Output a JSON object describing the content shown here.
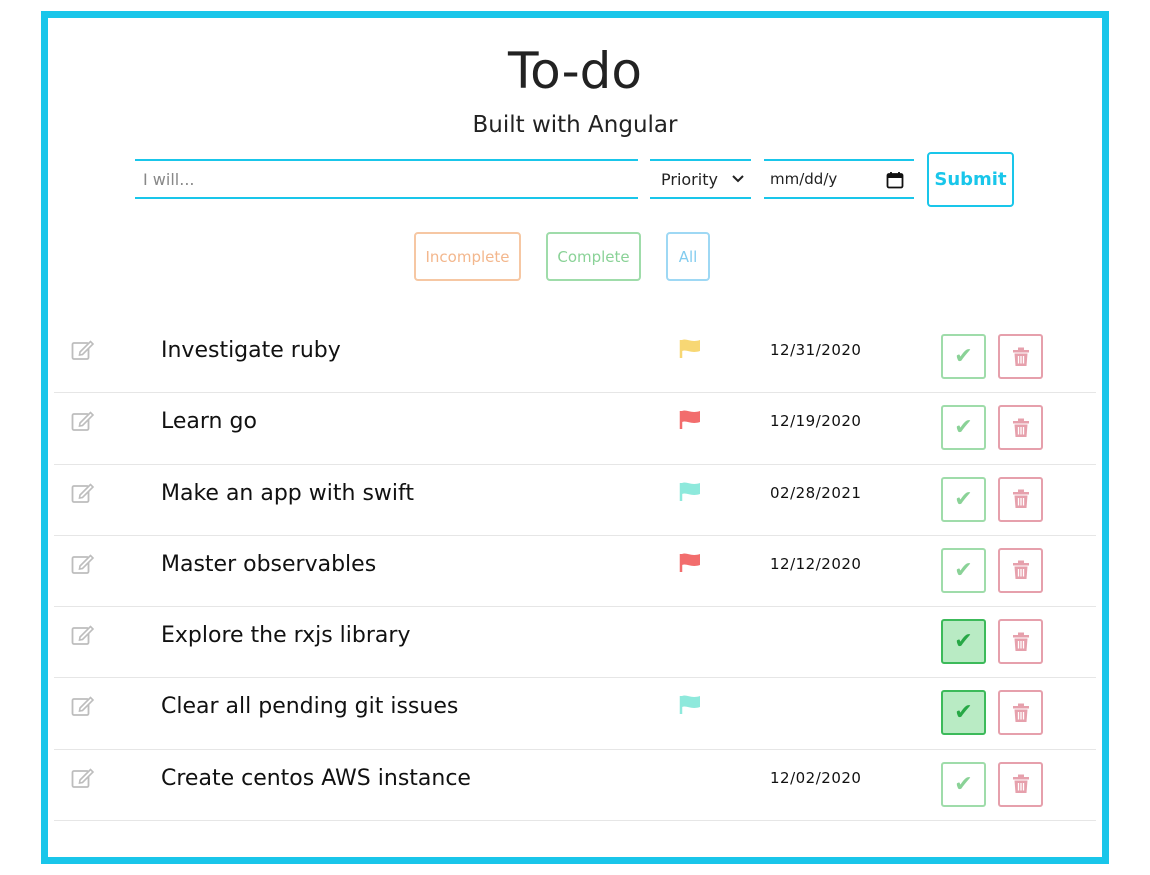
{
  "header": {
    "title": "To-do",
    "subtitle": "Built with Angular"
  },
  "form": {
    "task_placeholder": "I will...",
    "priority_label": "Priority",
    "date_placeholder": "mm/dd/y",
    "submit_label": "Submit"
  },
  "filters": {
    "incomplete": "Incomplete",
    "complete": "Complete",
    "all": "All"
  },
  "colors": {
    "accent": "#19c6ea",
    "flag_yellow": "#f7d774",
    "flag_red": "#f26d6d",
    "flag_teal": "#8ee9dc"
  },
  "todos": [
    {
      "text": "Investigate ruby",
      "flag": "yellow",
      "date": "12/31/2020",
      "done": false
    },
    {
      "text": "Learn go",
      "flag": "red",
      "date": "12/19/2020",
      "done": false
    },
    {
      "text": "Make an app with swift",
      "flag": "teal",
      "date": "02/28/2021",
      "done": false
    },
    {
      "text": "Master observables",
      "flag": "red",
      "date": "12/12/2020",
      "done": false
    },
    {
      "text": "Explore the rxjs library",
      "flag": "",
      "date": "",
      "done": true
    },
    {
      "text": "Clear all pending git issues",
      "flag": "teal",
      "date": "",
      "done": true
    },
    {
      "text": "Create centos AWS instance",
      "flag": "",
      "date": "12/02/2020",
      "done": false
    }
  ]
}
